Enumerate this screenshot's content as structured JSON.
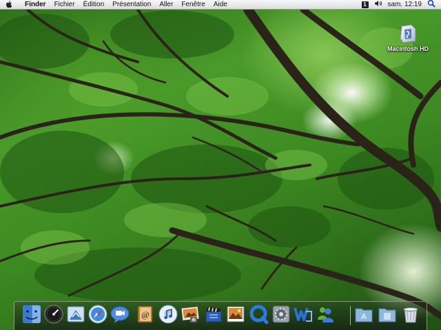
{
  "menubar": {
    "app_name": "Finder",
    "menus": [
      "Fichier",
      "Édition",
      "Présentation",
      "Aller",
      "Fenêtre",
      "Aide"
    ],
    "space_number": "1",
    "clock": "sam. 12:19"
  },
  "desktop": {
    "hd_label": "Macintosh HD"
  },
  "dock": {
    "items": [
      {
        "icon": "finder-icon"
      },
      {
        "icon": "dashboard-icon"
      },
      {
        "icon": "mail-icon"
      },
      {
        "icon": "safari-icon"
      },
      {
        "icon": "ichat-icon"
      },
      {
        "icon": "address-book-icon"
      },
      {
        "icon": "itunes-icon"
      },
      {
        "icon": "iphoto-icon"
      },
      {
        "icon": "imovie-icon"
      },
      {
        "icon": "preview-icon"
      },
      {
        "icon": "quicktime-icon"
      },
      {
        "icon": "system-preferences-icon"
      },
      {
        "icon": "word-icon"
      },
      {
        "icon": "messenger-icon"
      },
      {
        "icon": "applications-folder-icon"
      },
      {
        "icon": "documents-folder-icon"
      },
      {
        "icon": "trash-icon"
      }
    ]
  }
}
